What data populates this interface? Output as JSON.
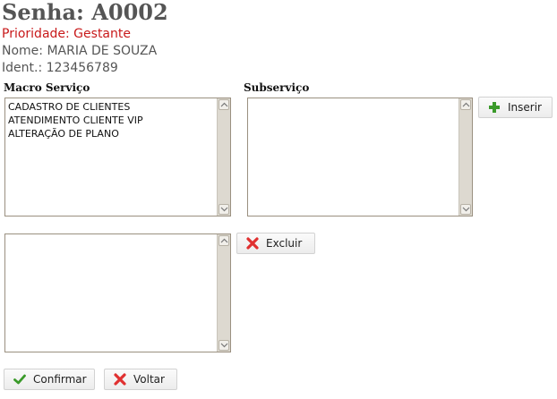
{
  "header": {
    "title": "Senha: A0002",
    "prioridade": "Prioridade: Gestante",
    "nome": "Nome: MARIA DE SOUZA",
    "ident": "Ident.: 123456789"
  },
  "macro_servico": {
    "label": "Macro Serviço",
    "items": [
      "CADASTRO DE CLIENTES",
      "ATENDIMENTO CLIENTE VIP",
      "ALTERAÇÃO DE PLANO"
    ]
  },
  "subservico": {
    "label": "Subserviço",
    "items": []
  },
  "selecionados": {
    "items": []
  },
  "buttons": {
    "inserir": "Inserir",
    "excluir": "Excluir",
    "confirmar": "Confirmar",
    "voltar": "Voltar"
  },
  "colors": {
    "priority": "#c8191a",
    "plus_icon": "#3a9a2a",
    "x_icon": "#e03030",
    "check_icon": "#3a9a2a"
  },
  "icons": {
    "inserir": "plus-icon",
    "excluir": "x-icon",
    "confirmar": "check-icon",
    "voltar": "x-icon"
  }
}
